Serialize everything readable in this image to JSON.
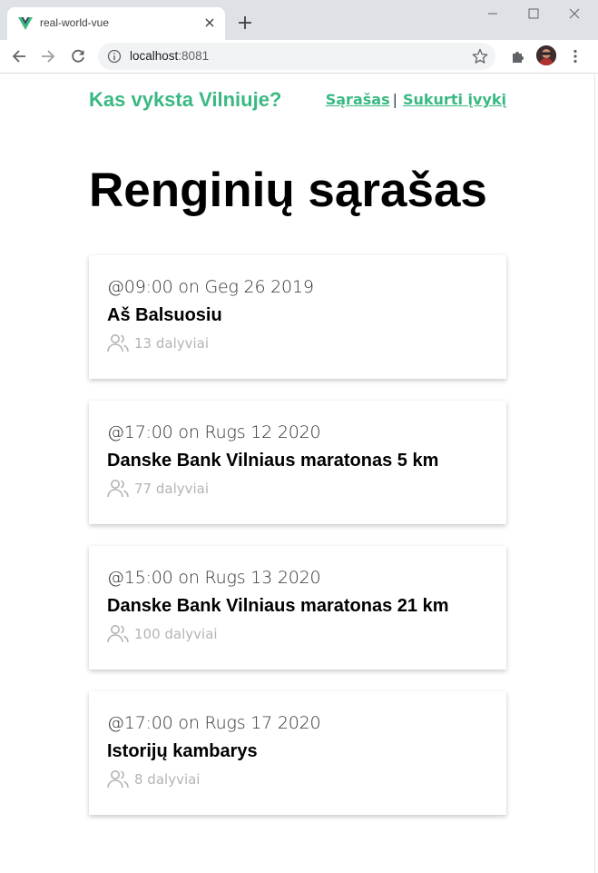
{
  "browser": {
    "tab_title": "real-world-vue",
    "url_host": "localhost",
    "url_port": ":8081"
  },
  "header": {
    "brand": "Kas vyksta Vilniuje?",
    "nav": [
      {
        "label": "Sąrašas"
      },
      {
        "separator": "|"
      },
      {
        "label": "Sukurti įvykį"
      }
    ]
  },
  "main": {
    "title": "Renginių sąrašas",
    "events": [
      {
        "date": "@09:00 on Geg 26 2019",
        "title": "Aš Balsuosiu",
        "attendees": "13 dalyviai"
      },
      {
        "date": "@17:00 on Rugs 12 2020",
        "title": "Danske Bank Vilniaus maratonas 5 km",
        "attendees": "77 dalyviai"
      },
      {
        "date": "@15:00 on Rugs 13 2020",
        "title": "Danske Bank Vilniaus maratonas 21 km",
        "attendees": "100 dalyviai"
      },
      {
        "date": "@17:00 on Rugs 17 2020",
        "title": "Istorijų kambarys",
        "attendees": "8 dalyviai"
      }
    ]
  },
  "colors": {
    "accent": "#39b982",
    "muted": "#b4b4b4"
  },
  "icons": {
    "attendees": "users-icon"
  }
}
